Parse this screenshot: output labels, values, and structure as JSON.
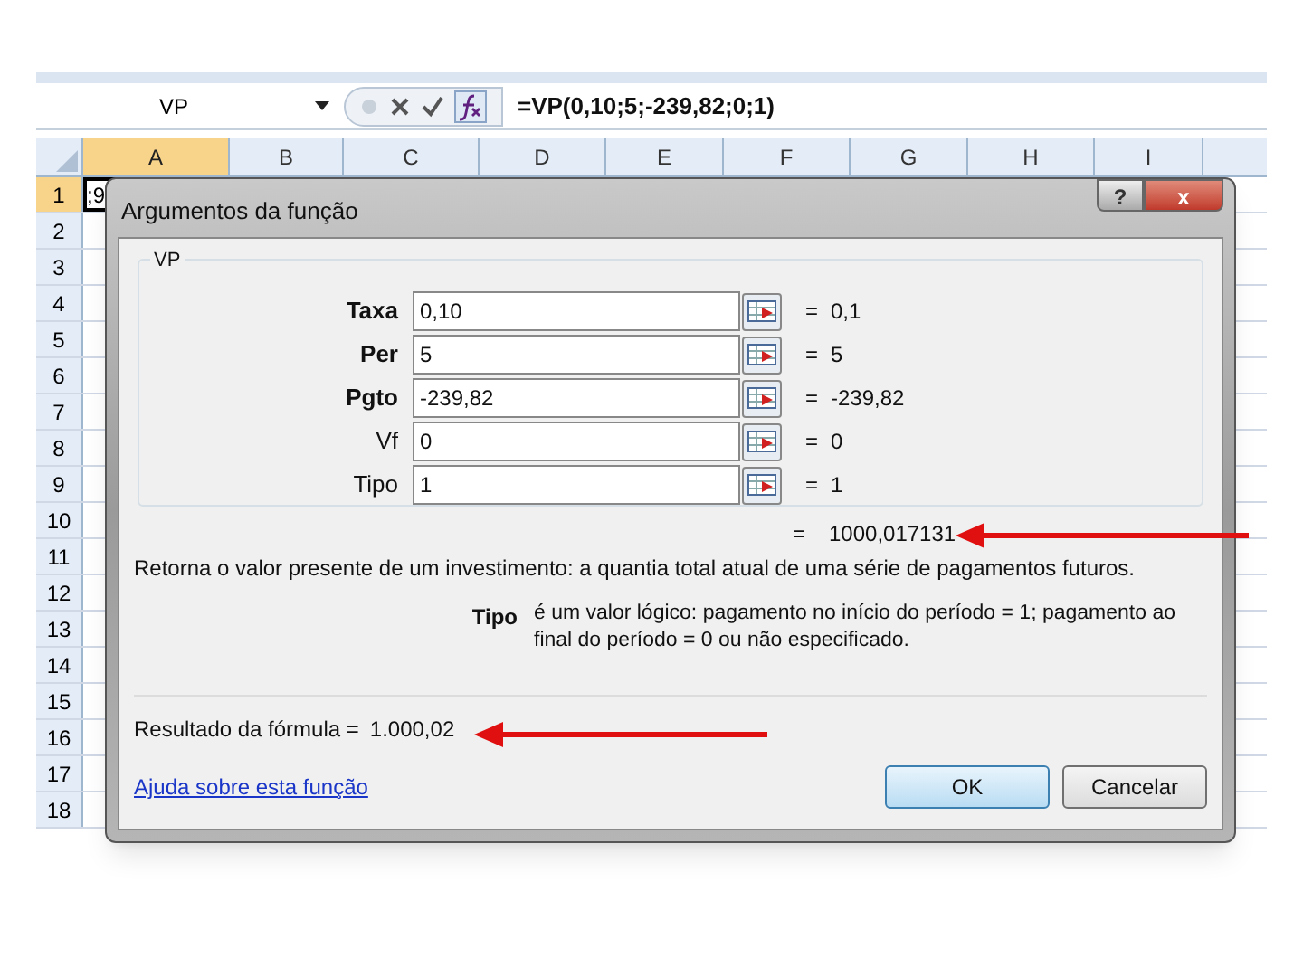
{
  "formula_bar": {
    "name_box": "VP",
    "formula": "=VP(0,10;5;-239,82;0;1)"
  },
  "sheet": {
    "columns": [
      {
        "label": "A",
        "selected": true
      },
      {
        "label": "B",
        "selected": false
      },
      {
        "label": "C",
        "selected": false
      },
      {
        "label": "D",
        "selected": false
      },
      {
        "label": "E",
        "selected": false
      },
      {
        "label": "F",
        "selected": false
      },
      {
        "label": "G",
        "selected": false
      },
      {
        "label": "H",
        "selected": false
      },
      {
        "label": "I",
        "selected": false
      }
    ],
    "rows": [
      {
        "label": "1",
        "selected": true
      },
      {
        "label": "2",
        "selected": false
      },
      {
        "label": "3",
        "selected": false
      },
      {
        "label": "4",
        "selected": false
      },
      {
        "label": "5",
        "selected": false
      },
      {
        "label": "6",
        "selected": false
      },
      {
        "label": "7",
        "selected": false
      },
      {
        "label": "8",
        "selected": false
      },
      {
        "label": "9",
        "selected": false
      },
      {
        "label": "10",
        "selected": false
      },
      {
        "label": "11",
        "selected": false
      },
      {
        "label": "12",
        "selected": false
      },
      {
        "label": "13",
        "selected": false
      },
      {
        "label": "14",
        "selected": false
      },
      {
        "label": "15",
        "selected": false
      },
      {
        "label": "16",
        "selected": false
      },
      {
        "label": "17",
        "selected": false
      },
      {
        "label": "18",
        "selected": false
      }
    ],
    "cell_a1": ";9"
  },
  "dialog": {
    "title": "Argumentos da função",
    "help_button": "?",
    "close_button": "x",
    "group": "VP",
    "arguments": [
      {
        "label": "Taxa",
        "required": true,
        "value": "0,10",
        "equals": "=",
        "result": "0,1"
      },
      {
        "label": "Per",
        "required": true,
        "value": "5",
        "equals": "=",
        "result": "5"
      },
      {
        "label": "Pgto",
        "required": true,
        "value": "-239,82",
        "equals": "=",
        "result": "-239,82"
      },
      {
        "label": "Vf",
        "required": false,
        "value": "0",
        "equals": "=",
        "result": "0"
      },
      {
        "label": "Tipo",
        "required": false,
        "value": "1",
        "equals": "=",
        "result": "1"
      }
    ],
    "total_equals": "=",
    "total": "1000,017131",
    "description": "Retorna o valor presente de um investimento: a quantia total atual de uma série de pagamentos futuros.",
    "arg_help_label": "Tipo",
    "arg_help": "é um valor lógico: pagamento no início do período = 1; pagamento ao final do período = 0 ou não especificado.",
    "formula_result_label": "Resultado da fórmula =",
    "formula_result": "1.000,02",
    "help_link": "Ajuda sobre esta função",
    "ok": "OK",
    "cancel": "Cancelar"
  }
}
